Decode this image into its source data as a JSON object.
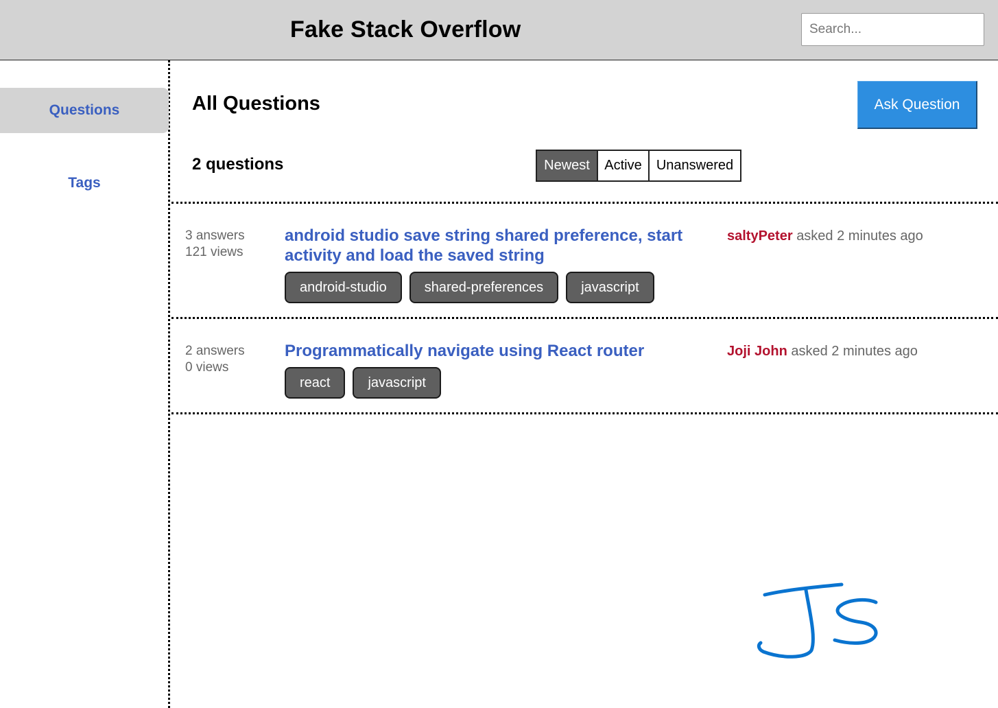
{
  "header": {
    "title": "Fake Stack Overflow",
    "search_placeholder": "Search..."
  },
  "sidebar": {
    "items": [
      {
        "label": "Questions",
        "active": true
      },
      {
        "label": "Tags",
        "active": false
      }
    ]
  },
  "main": {
    "title": "All Questions",
    "ask_button": "Ask Question",
    "count_label": "2 questions",
    "sort_buttons": [
      {
        "label": "Newest",
        "active": true
      },
      {
        "label": "Active",
        "active": false
      },
      {
        "label": "Unanswered",
        "active": false
      }
    ],
    "questions": [
      {
        "answers": "3 answers",
        "views": "121 views",
        "title": "android studio save string shared preference, start activity and load the saved string",
        "tags": [
          "android-studio",
          "shared-preferences",
          "javascript"
        ],
        "user": "saltyPeter",
        "asked": "asked 2 minutes ago"
      },
      {
        "answers": "2 answers",
        "views": "0 views",
        "title": "Programmatically navigate using React router",
        "tags": [
          "react",
          "javascript"
        ],
        "user": "Joji John",
        "asked": "asked 2 minutes ago"
      }
    ]
  },
  "handwriting": {
    "text": "JS",
    "color": "#0a74d0"
  },
  "colors": {
    "header_bg": "#d3d3d3",
    "link": "#3a5fc0",
    "username": "#b3122e",
    "ask_button": "#2d8ee0",
    "tag_bg": "#5f5f5f"
  }
}
